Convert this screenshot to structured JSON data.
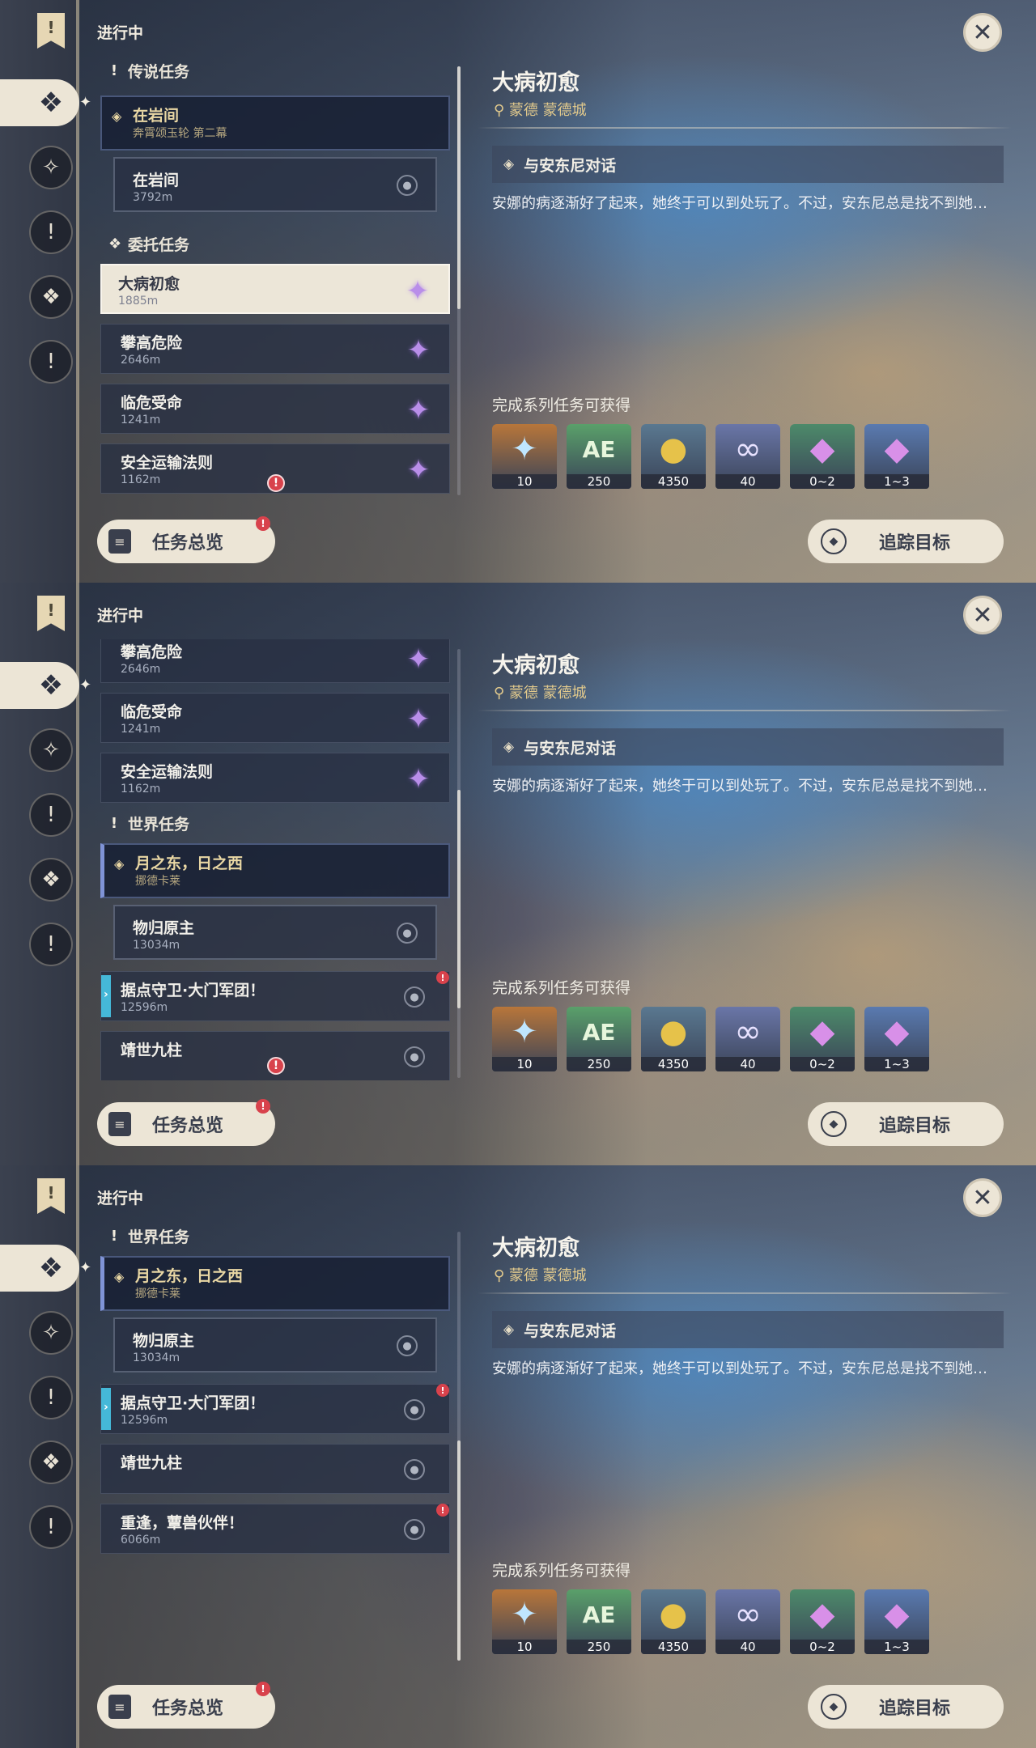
{
  "colors": {
    "accent": "#ece5d6",
    "gold": "#e1c98c",
    "alert": "#d8424c",
    "purple_gem": "#b98ee9"
  },
  "header": {
    "in_progress": "进行中"
  },
  "rail": {
    "icons": [
      "bookmark-icon",
      "diamond-quest-icon",
      "archon-quest-icon",
      "story-quest-icon",
      "world-quest-icon",
      "daily-quest-icon"
    ]
  },
  "lists": {
    "p1": {
      "sec_legend": "传说任务",
      "legend_parent": {
        "title": "在岩间",
        "sub": "奔霄颂玉轮 第二幕"
      },
      "legend_child": {
        "title": "在岩间",
        "sub": "3792m"
      },
      "sec_commission": "委托任务",
      "c1": {
        "title": "大病初愈",
        "sub": "1885m"
      },
      "c2": {
        "title": "攀高危险",
        "sub": "2646m"
      },
      "c3": {
        "title": "临危受命",
        "sub": "1241m"
      },
      "c4": {
        "title": "安全运输法则",
        "sub": "1162m"
      }
    },
    "p2": {
      "c2": {
        "title": "攀高危险",
        "sub": "2646m"
      },
      "c3": {
        "title": "临危受命",
        "sub": "1241m"
      },
      "c4": {
        "title": "安全运输法则",
        "sub": "1162m"
      },
      "sec_world": "世界任务",
      "w_parent": {
        "title": "月之东，日之西",
        "sub": "挪德卡莱"
      },
      "w_child": {
        "title": "物归原主",
        "sub": "13034m"
      },
      "w2": {
        "title": "据点守卫·大门军团！",
        "sub": "12596m"
      },
      "w3": {
        "title": "靖世九柱",
        "sub": ""
      }
    },
    "p3": {
      "sec_world": "世界任务",
      "w_parent": {
        "title": "月之东，日之西",
        "sub": "挪德卡莱"
      },
      "w_child": {
        "title": "物归原主",
        "sub": "13034m"
      },
      "w2": {
        "title": "据点守卫·大门军团！",
        "sub": "12596m"
      },
      "w3": {
        "title": "靖世九柱",
        "sub": ""
      },
      "w4": {
        "title": "重逢，蕈兽伙伴！",
        "sub": "6066m"
      }
    }
  },
  "detail": {
    "title": "大病初愈",
    "location": "蒙德 蒙德城",
    "step": "与安东尼对话",
    "description": "安娜的病逐渐好了起来，她终于可以到处玩了。不过，安东尼总是找不到她…",
    "rewards_header": "完成系列任务可获得",
    "rewards": [
      {
        "icon": "primogem-icon",
        "count": "10",
        "bg": "#b8763a",
        "glyph": "✦",
        "color": "#bfe6ff"
      },
      {
        "icon": "adventure-exp-icon",
        "count": "250",
        "bg": "#5aa06a",
        "glyph": "AE",
        "color": "#e7f6dc"
      },
      {
        "icon": "mora-icon",
        "count": "4350",
        "bg": "#5a7890",
        "glyph": "●",
        "color": "#e6c24a"
      },
      {
        "icon": "companionship-exp-icon",
        "count": "40",
        "bg": "#6a76a8",
        "glyph": "∞",
        "color": "#e8e2ff"
      },
      {
        "icon": "crystal-icon",
        "count": "0~2",
        "bg": "#4d8a6a",
        "glyph": "◆",
        "color": "#d890e8"
      },
      {
        "icon": "crystal-cluster-icon",
        "count": "1~3",
        "bg": "#5a7ab0",
        "glyph": "◆",
        "color": "#d890e8"
      }
    ]
  },
  "buttons": {
    "overview": "任务总览",
    "track": "追踪目标",
    "badge": "!"
  }
}
